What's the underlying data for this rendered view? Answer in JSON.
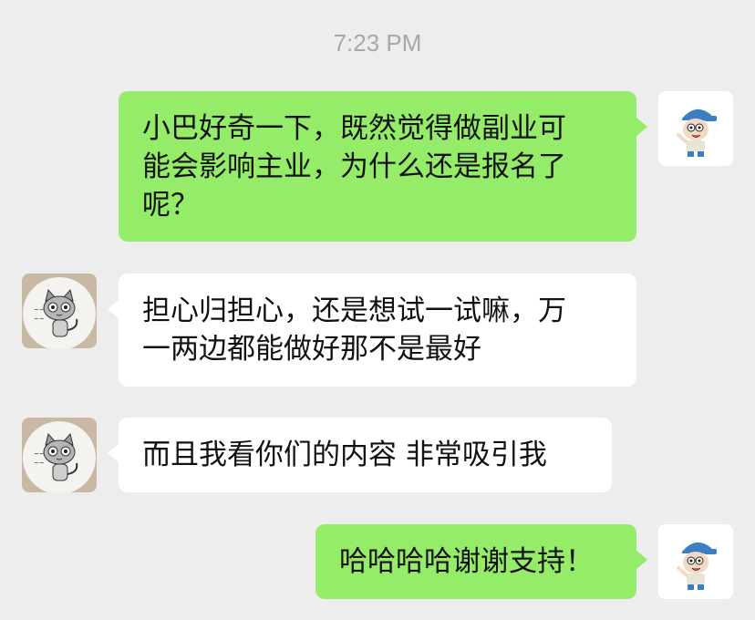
{
  "chat": {
    "timestamp": "7:23 PM",
    "messages": [
      {
        "side": "sent",
        "lines": [
          "小巴好奇一下，既然觉得做副业可",
          "能会影响主业，为什么还是报名了",
          "呢？"
        ],
        "avatar_icon": "cartoon-boy-avatar-icon"
      },
      {
        "side": "received",
        "lines": [
          "担心归担心，还是想试一试嘛，万",
          "一两边都能做好那不是最好"
        ],
        "avatar_icon": "cartoon-cat-avatar-icon"
      },
      {
        "side": "received",
        "lines": [
          "而且我看你们的内容 非常吸引我"
        ],
        "avatar_icon": "cartoon-cat-avatar-icon"
      },
      {
        "side": "sent",
        "lines": [
          "哈哈哈哈谢谢支持！"
        ],
        "avatar_icon": "cartoon-boy-avatar-icon"
      }
    ]
  },
  "colors": {
    "background": "#ededed",
    "sent_bubble": "#95ec69",
    "received_bubble": "#ffffff",
    "timestamp_text": "#a8a8a8"
  }
}
